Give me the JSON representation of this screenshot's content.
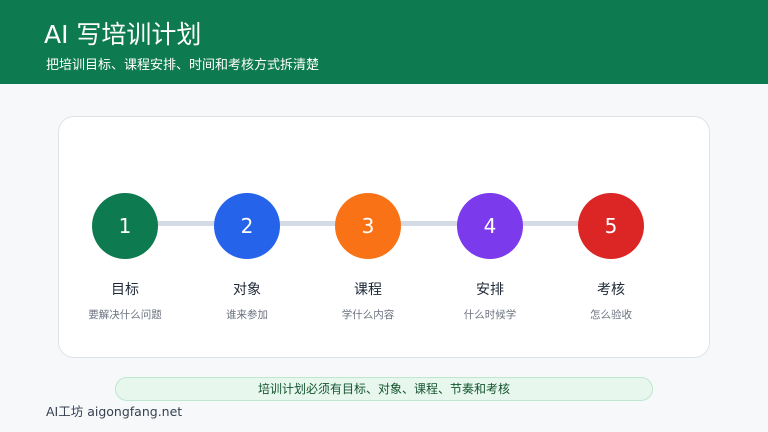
{
  "header": {
    "title": "AI 写培训计划",
    "subtitle": "把培训目标、课程安排、时间和考核方式拆清楚",
    "background": "#0e7a4f"
  },
  "steps": [
    {
      "number": "1",
      "title": "目标",
      "description": "要解决什么问题",
      "color": "#0e7a4f"
    },
    {
      "number": "2",
      "title": "对象",
      "description": "谁来参加",
      "color": "#2563eb"
    },
    {
      "number": "3",
      "title": "课程",
      "description": "学什么内容",
      "color": "#f97316"
    },
    {
      "number": "4",
      "title": "安排",
      "description": "什么时候学",
      "color": "#7c3aed"
    },
    {
      "number": "5",
      "title": "考核",
      "description": "怎么验收",
      "color": "#dc2626"
    }
  ],
  "summary": "培训计划必须有目标、对象、课程、节奏和考核",
  "footer": "AI工坊 aigongfang.net"
}
